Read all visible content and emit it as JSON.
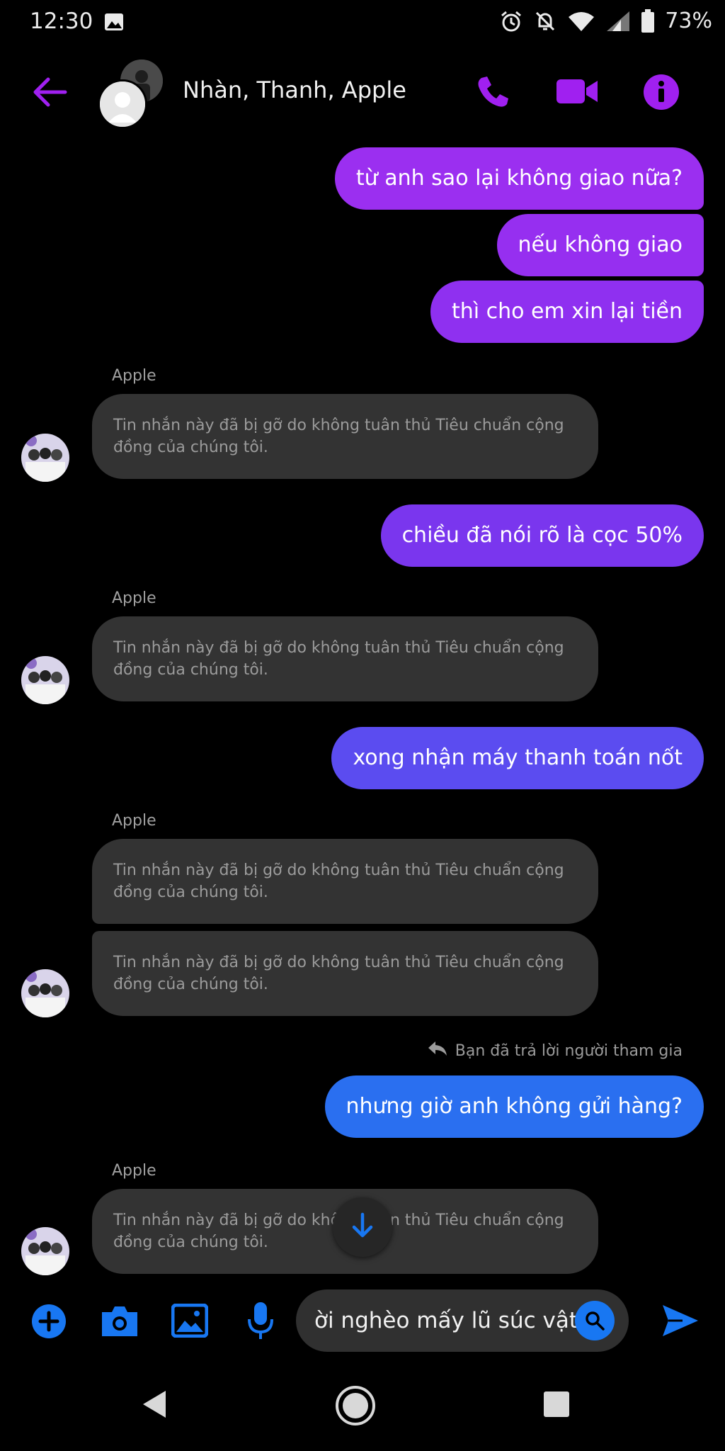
{
  "status_bar": {
    "time": "12:30",
    "battery": "73%",
    "icons": [
      "image-icon",
      "alarm-icon",
      "mute-icon",
      "wifi-icon",
      "signal-icon",
      "battery-icon"
    ]
  },
  "header": {
    "title": "Nhàn, Thanh, Apple",
    "accent": "#a020f0",
    "icons": [
      "back-arrow-icon",
      "phone-icon",
      "video-icon",
      "info-icon"
    ]
  },
  "messages": {
    "out1": "từ anh sao lại không giao nữa?",
    "out2": "nếu không giao",
    "out3": "thì cho em xin lại tiền",
    "sender1": "Apple",
    "removed1": "Tin nhắn này đã bị gỡ do không tuân thủ Tiêu chuẩn cộng đồng của chúng tôi.",
    "out4": "chiều đã nói rõ là cọc 50%",
    "sender2": "Apple",
    "removed2": "Tin nhắn này đã bị gỡ do không tuân thủ Tiêu chuẩn cộng đồng của chúng tôi.",
    "out5": "xong nhận máy thanh toán nốt",
    "sender3": "Apple",
    "removed3": "Tin nhắn này đã bị gỡ do không tuân thủ Tiêu chuẩn cộng đồng của chúng tôi.",
    "removed4": "Tin nhắn này đã bị gỡ do không tuân thủ Tiêu chuẩn cộng đồng của chúng tôi.",
    "reply_note": "Bạn đã trả lời người tham gia",
    "out6": "nhưng giờ anh không gửi hàng?",
    "sender4": "Apple",
    "removed5": "Tin nhắn này đã bị gỡ do không tuân thủ Tiêu chuẩn cộng đồng của chúng tôi."
  },
  "colors": {
    "bubble_purple": "#9b2ff0",
    "bubble_violet": "#7a36ee",
    "bubble_indigo": "#5b4cf0",
    "bubble_blue": "#2a6ff0",
    "incoming_bg": "#333333",
    "toolbar_blue": "#1877f2"
  },
  "composer": {
    "value": "ời nghèo mấy lũ súc vật",
    "toolbar_icons": [
      "plus-icon",
      "camera-icon",
      "gallery-icon",
      "microphone-icon",
      "search-icon",
      "send-icon"
    ]
  },
  "navbar": {
    "icons": [
      "nav-back-icon",
      "nav-home-icon",
      "nav-recents-icon"
    ]
  }
}
